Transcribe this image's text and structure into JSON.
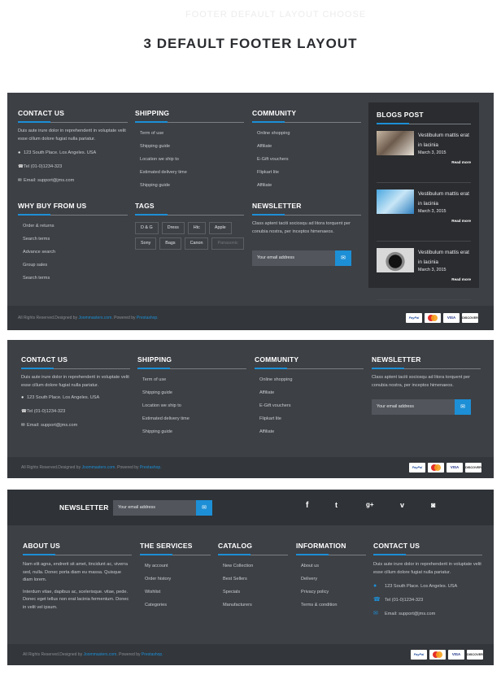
{
  "heading": {
    "faint_top": "FOOTER DEFAULT LAYOUT CHOOSE",
    "title": "3 DEFAULT FOOTER LAYOUT"
  },
  "icons": {
    "map": "map-marker-icon",
    "phone": "phone-icon",
    "mail": "envelope-icon",
    "send": "send-envelope-icon",
    "facebook": "facebook-icon",
    "twitter": "twitter-icon",
    "gplus": "google-plus-icon",
    "vimeo": "vimeo-icon",
    "instagram": "instagram-icon"
  },
  "colors": {
    "accent": "#1d8fd6",
    "panel": "#3d4045",
    "bar": "#33363a"
  },
  "footer1": {
    "contact": {
      "title": "CONTACT US",
      "desc": "Duis aute irure dolor in reprehenderit in voluptate velit esse cillum dolore fugiat nulla pariatur.",
      "address": "123 South Place. Los Angeles. USA",
      "phone": "Tel (01-0)1234-323",
      "email": "Email: support@jms.com"
    },
    "shipping": {
      "title": "SHIPPING",
      "items": [
        "Term of use",
        "Shipping guide",
        "Location we ship to",
        "Estimated delivery time",
        "Shipping guide"
      ]
    },
    "community": {
      "title": "COMMUNITY",
      "items": [
        "Online shopping",
        "Affiliate",
        "E-Gift vouchers",
        "Flipkart lite",
        "Affiliate"
      ]
    },
    "why": {
      "title": "WHY BUY FROM US",
      "items": [
        "Order & returns",
        "Search terms",
        "Advance search",
        "Group sales",
        "Search terms"
      ]
    },
    "tags": {
      "title": "TAGS",
      "items": [
        "D & G",
        "Dress",
        "Htc",
        "Apple",
        "Sony",
        "Bags",
        "Canon",
        "Panasonic"
      ]
    },
    "newsletter": {
      "title": "NEWSLETTER",
      "desc": "Class aptent taciti sociosqu ad litora torquent per conubia nostra, per inceptos himenaeos.",
      "placeholder": "Your email address"
    },
    "blogs": {
      "title": "BLOGS POST",
      "posts": [
        {
          "title": "Vestibulum mattis erat in lacinia",
          "date": "March 3, 2015",
          "more": "Read more"
        },
        {
          "title": "Vestibulum mattis erat in lacinia",
          "date": "March 3, 2015",
          "more": "Read more"
        },
        {
          "title": "Vestibulum mattis erat in lacinia",
          "date": "March 3, 2015",
          "more": "Read more"
        }
      ]
    },
    "bottom": {
      "prefix": "All Rights Reserved.Designed by ",
      "brand": "Joommasters.com",
      "mid": ". Powered by ",
      "powered": "Prestashop."
    }
  },
  "footer2": {
    "contact": {
      "title": "CONTACT US",
      "desc": "Duis aute irure dolor in reprehenderit in voluptate velit esse cillum dolore fugiat nulla pariatur.",
      "address": "123 South Place. Los Angeles. USA",
      "phone": "Tel (01-0)1234-323",
      "email": "Email: support@jms.com"
    },
    "shipping": {
      "title": "SHIPPING",
      "items": [
        "Term of use",
        "Shipping guide",
        "Location we ship to",
        "Estimated delivery time",
        "Shipping guide"
      ]
    },
    "community": {
      "title": "COMMUNITY",
      "items": [
        "Online shopping",
        "Affiliate",
        "E-Gift vouchers",
        "Flipkart lite",
        "Affiliate"
      ]
    },
    "newsletter": {
      "title": "NEWSLETTER",
      "desc": "Class aptent taciti sociosqu ad litora torquent per conubia nostra, per inceptos himenaeos.",
      "placeholder": "Your email address"
    },
    "bottom": {
      "prefix": "All Rights Reserved.Designed by ",
      "brand": "Joommasters.com",
      "mid": ". Powered by ",
      "powered": "Prestashop."
    }
  },
  "footer3": {
    "newsletter": {
      "title": "NEWSLETTER",
      "placeholder": "Your email address"
    },
    "about": {
      "title": "ABOUT US",
      "p1": "Nam elit agna, endrerit sit amet, tincidunt ac, viverra sed, nulla. Donec porta diam eu massa. Quisque diam lorem.",
      "p2": "Interdum vitae, dapibus ac, scelerisque. vitae, pede. Donec eget tellus non erat lacinia fermentum. Donec in velit vel ipsum."
    },
    "services": {
      "title": "THE SERVICES",
      "items": [
        "My account",
        "Order history",
        "Wishlist",
        "Categories"
      ]
    },
    "catalog": {
      "title": "CATALOG",
      "items": [
        "New Collection",
        "Best Sellers",
        "Specials",
        "Manufacturers"
      ]
    },
    "information": {
      "title": "INFORMATION",
      "items": [
        "About us",
        "Delivery",
        "Privacy policy",
        "Terms & condition"
      ]
    },
    "contact": {
      "title": "CONTACT US",
      "desc": "Duis aute irure dolor in reprehenderit in voluptate velit esse cillum dolore fugiat nulla pariatur.",
      "address": "123 South Place. Los Angeles. USA",
      "phone": "Tel (01-0)1234-323",
      "email": "Email: support@jms.com"
    },
    "bottom": {
      "prefix": "All Rights Reserved.Designed by ",
      "brand": "Joommasters.com",
      "mid": ". Powered by ",
      "powered": "Prestashop."
    }
  },
  "payments": [
    "PayPal",
    "MasterCard",
    "VISA",
    "DISCOVER"
  ]
}
